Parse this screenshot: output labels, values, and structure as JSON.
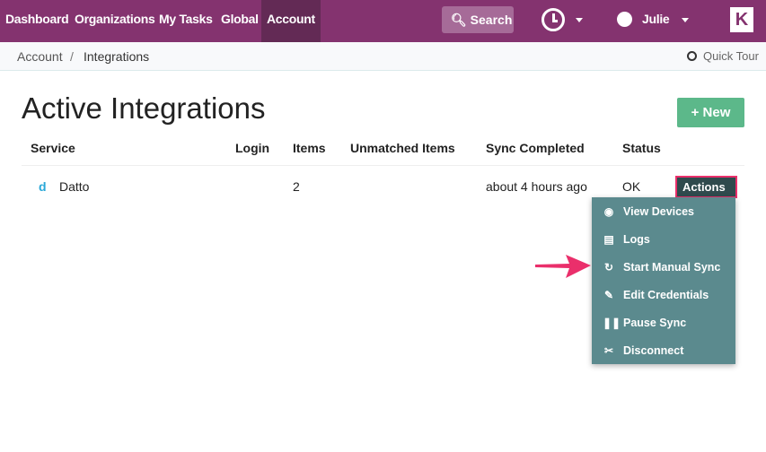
{
  "nav": {
    "items": [
      "Dashboard",
      "Organizations",
      "My Tasks",
      "Global",
      "Account"
    ],
    "active": "Account",
    "search_label": "Search",
    "user": "Julie",
    "logo": "K"
  },
  "breadcrumb": {
    "items": [
      "Account",
      "Integrations"
    ],
    "separator": "/",
    "quick_tour": "Quick Tour"
  },
  "page": {
    "title": "Active Integrations",
    "new_button": "New"
  },
  "table": {
    "columns": [
      "Service",
      "Login",
      "Items",
      "Unmatched Items",
      "Sync Completed",
      "Status"
    ],
    "rows": [
      {
        "icon": "d",
        "service": "Datto",
        "login": "",
        "items": "2",
        "unmatched": "",
        "sync": "about 4 hours ago",
        "status": "OK",
        "actions": "Actions"
      }
    ]
  },
  "menu": {
    "items": [
      {
        "icon": "eye-icon",
        "label": "View Devices"
      },
      {
        "icon": "file-icon",
        "label": "Logs"
      },
      {
        "icon": "refresh-icon",
        "label": "Start Manual Sync"
      },
      {
        "icon": "pencil-icon",
        "label": "Edit Credentials"
      },
      {
        "icon": "pause-icon",
        "label": "Pause Sync"
      },
      {
        "icon": "unlink-icon",
        "label": "Disconnect"
      }
    ]
  },
  "colors": {
    "nav": "#84336f",
    "active": "#632a55",
    "menu": "#5b8a8e",
    "highlight": "#ea2f6b",
    "new": "#5cb88a"
  }
}
